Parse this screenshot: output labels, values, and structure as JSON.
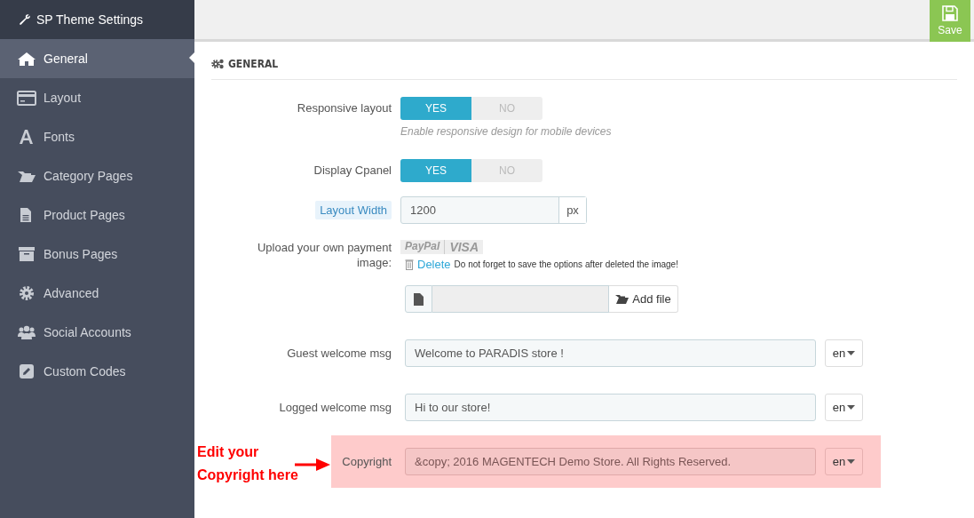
{
  "sidebar": {
    "title": "SP Theme Settings",
    "items": [
      {
        "label": "General",
        "selected": true
      },
      {
        "label": "Layout",
        "selected": false
      },
      {
        "label": "Fonts",
        "selected": false
      },
      {
        "label": "Category Pages",
        "selected": false
      },
      {
        "label": "Product Pages",
        "selected": false
      },
      {
        "label": "Bonus Pages",
        "selected": false
      },
      {
        "label": "Advanced",
        "selected": false
      },
      {
        "label": "Social Accounts",
        "selected": false
      },
      {
        "label": "Custom Codes",
        "selected": false
      }
    ]
  },
  "save_button": "Save",
  "section_title": "GENERAL",
  "fields": [
    {
      "kind": "toggle",
      "label": "Responsive layout",
      "options": [
        {
          "label": "YES",
          "selected": true
        },
        {
          "label": "NO",
          "selected": false
        }
      ],
      "help": "Enable responsive design for mobile devices"
    },
    {
      "kind": "toggle",
      "label": "Display Cpanel",
      "options": [
        {
          "label": "YES",
          "selected": true
        },
        {
          "label": "NO",
          "selected": false
        }
      ]
    },
    {
      "kind": "addon",
      "label": "Layout Width",
      "value": "1200",
      "addon": "px"
    },
    {
      "kind": "upload",
      "label": "Upload your own payment image:",
      "brands": [
        "PayPal",
        "VISA"
      ],
      "delete_link": "Delete",
      "note": "Do not forget to save the options after deleted the image!",
      "button": "Add file"
    },
    {
      "kind": "lang",
      "label": "Guest welcome msg",
      "value": "Welcome to PARADIS store !",
      "lang": "en",
      "highlighted": false
    },
    {
      "kind": "lang",
      "label": "Logged welcome msg",
      "value": "Hi to our store!",
      "lang": "en",
      "highlighted": false
    },
    {
      "kind": "lang",
      "label": "Copyright",
      "value": "&copy; 2016 MAGENTECH Demo Store. All Rights Reserved.",
      "lang": "en",
      "highlighted": true
    }
  ],
  "annotation": {
    "lines": [
      "Edit your",
      "Copyright here"
    ]
  }
}
